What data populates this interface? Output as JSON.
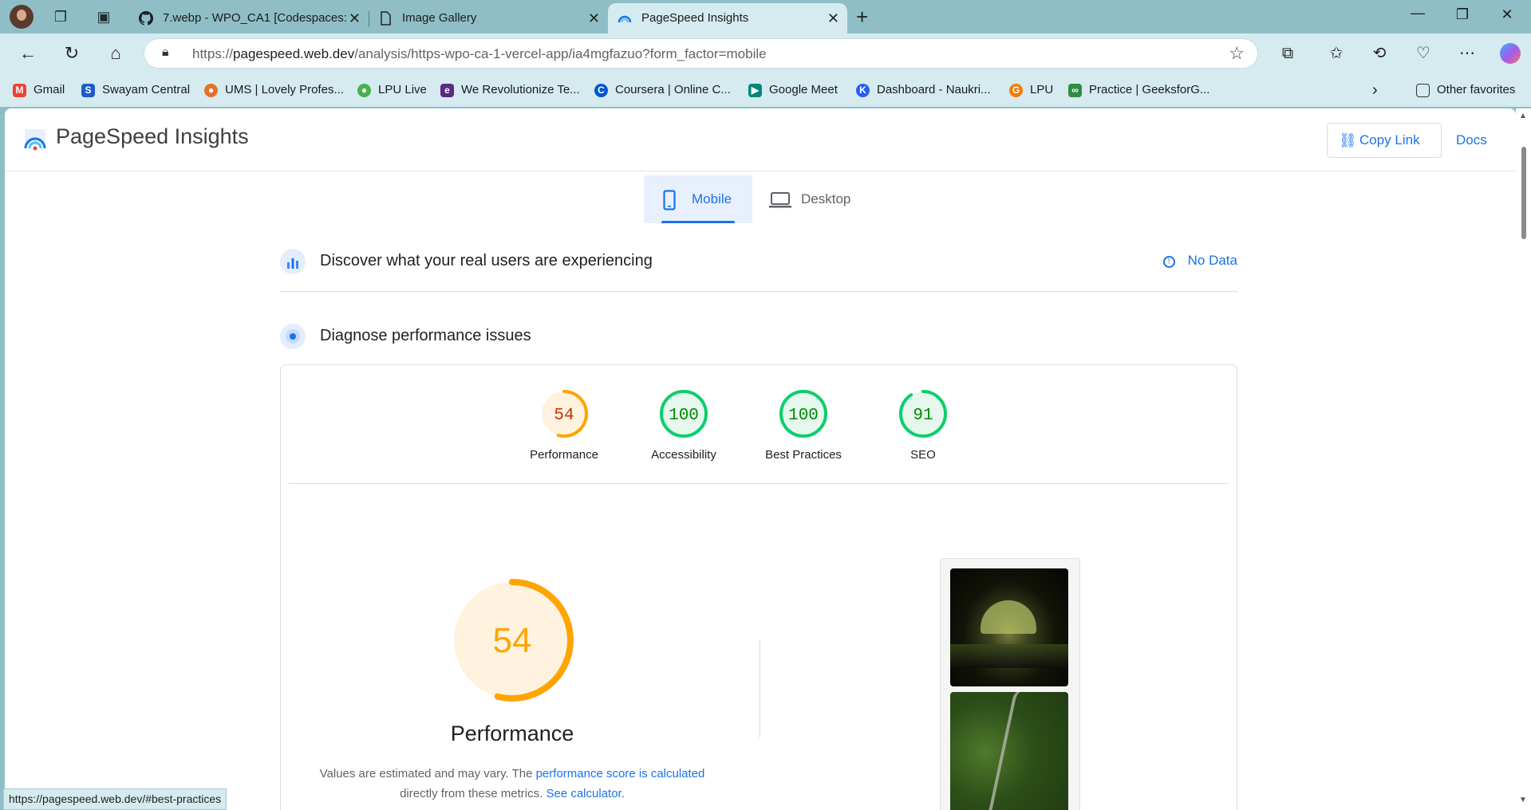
{
  "browser": {
    "tabs": [
      {
        "title": "7.webp - WPO_CA1 [Codespaces:",
        "icon": "github-icon",
        "active": false
      },
      {
        "title": "Image Gallery",
        "icon": "page-icon",
        "active": false
      },
      {
        "title": "PageSpeed Insights",
        "icon": "pagespeed-icon",
        "active": true
      }
    ],
    "new_tab_symbol": "+",
    "address": {
      "scheme": "https://",
      "host": "pagespeed.web.dev",
      "path": "/analysis/https-wpo-ca-1-vercel-app/ia4mgfazuo?form_factor=mobile"
    },
    "favorites": [
      {
        "label": "Gmail",
        "icon": "gmail-icon",
        "color": "#ea4335",
        "glyph": "M"
      },
      {
        "label": "Swayam Central",
        "icon": "swayam-icon",
        "color": "#1e5bc6",
        "glyph": "S"
      },
      {
        "label": "UMS | Lovely Profes...",
        "icon": "ums-icon",
        "color": "#e3722b",
        "glyph": "●"
      },
      {
        "label": "LPU Live",
        "icon": "lpu-live-icon",
        "color": "#4caf50",
        "glyph": "●"
      },
      {
        "label": "We Revolutionize Te...",
        "icon": "revolutionize-icon",
        "color": "#5b2a86",
        "glyph": "e"
      },
      {
        "label": "Coursera | Online C...",
        "icon": "coursera-icon",
        "color": "#0056d2",
        "glyph": "C"
      },
      {
        "label": "Google Meet",
        "icon": "google-meet-icon",
        "color": "#00897b",
        "glyph": "▶"
      },
      {
        "label": "Dashboard - Naukri...",
        "icon": "naukri-icon",
        "color": "#275df5",
        "glyph": "K"
      },
      {
        "label": "LPU",
        "icon": "lpu-icon",
        "color": "#f57c00",
        "glyph": "G"
      },
      {
        "label": "Practice | GeeksforG...",
        "icon": "geeksforgeeks-icon",
        "color": "#2f8d46",
        "glyph": "∞"
      }
    ],
    "other_favorites": "Other favorites",
    "status_url": "https://pagespeed.web.dev/#best-practices"
  },
  "psi": {
    "title": "PageSpeed Insights",
    "copy_link": "Copy Link",
    "docs": "Docs",
    "form_tabs": {
      "mobile": "Mobile",
      "desktop": "Desktop"
    },
    "real_users": {
      "title": "Discover what your real users are experiencing",
      "status": "No Data"
    },
    "diagnose": {
      "title": "Diagnose performance issues"
    },
    "scores": [
      {
        "label": "Performance",
        "value": 54,
        "color": "#ffa400",
        "text_color": "#c33300",
        "fill": "#fff3e0"
      },
      {
        "label": "Accessibility",
        "value": 100,
        "color": "#0cce6b",
        "text_color": "#008800",
        "fill": "#e6f8ee"
      },
      {
        "label": "Best Practices",
        "value": 100,
        "color": "#0cce6b",
        "text_color": "#008800",
        "fill": "#e6f8ee"
      },
      {
        "label": "SEO",
        "value": 91,
        "color": "#0cce6b",
        "text_color": "#008800",
        "fill": "#e6f8ee"
      }
    ],
    "performance_detail": {
      "score": 54,
      "title": "Performance",
      "desc_1": "Values are estimated and may vary. The ",
      "desc_link_1": "performance score is calculated",
      "desc_2": "directly from these metrics. ",
      "desc_link_2": "See calculator."
    }
  }
}
